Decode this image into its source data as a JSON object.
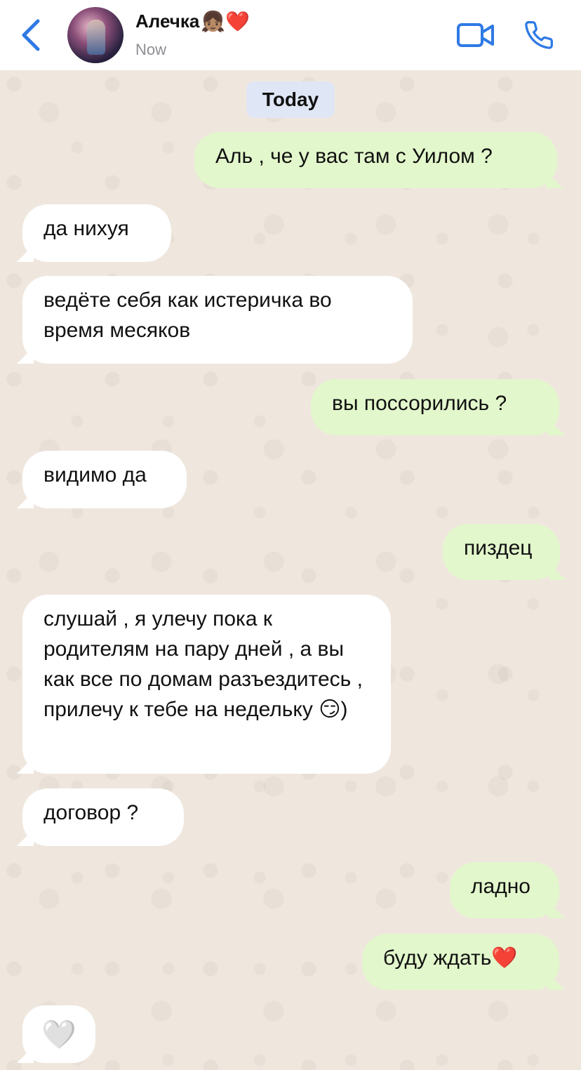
{
  "header": {
    "contact_name": "Алечка",
    "name_emojis": "👧🏽❤️",
    "status": "Now",
    "accent_color": "#2f7ae5"
  },
  "chat": {
    "date_label": "Today",
    "messages": [
      {
        "from": "me",
        "text": "Аль , че у вас там с Уилом ?"
      },
      {
        "from": "contact",
        "text": "да нихуя"
      },
      {
        "from": "contact",
        "text": "ведёте себя как истеричка во время месяков"
      },
      {
        "from": "me",
        "text": "вы поссорились ?"
      },
      {
        "from": "contact",
        "text": "видимо да"
      },
      {
        "from": "me",
        "text": "пиздец"
      },
      {
        "from": "contact",
        "text": "слушай , я улечу пока к родителям на пару дней , а вы как все по домам разъездитесь , прилечу к тебе на недельку 😏)"
      },
      {
        "from": "contact",
        "text": "договор ?"
      },
      {
        "from": "me",
        "text": "ладно"
      },
      {
        "from": "me",
        "text": "буду ждать❤️"
      },
      {
        "from": "contact",
        "text": "🤍"
      }
    ]
  },
  "colors": {
    "outgoing_bubble": "#e2f7cb",
    "incoming_bubble": "#ffffff",
    "date_pill": "#dfe6f5",
    "chat_background": "#efe7de"
  },
  "icons": {
    "back": "chevron-left-icon",
    "video": "video-camera-icon",
    "call": "phone-icon"
  }
}
